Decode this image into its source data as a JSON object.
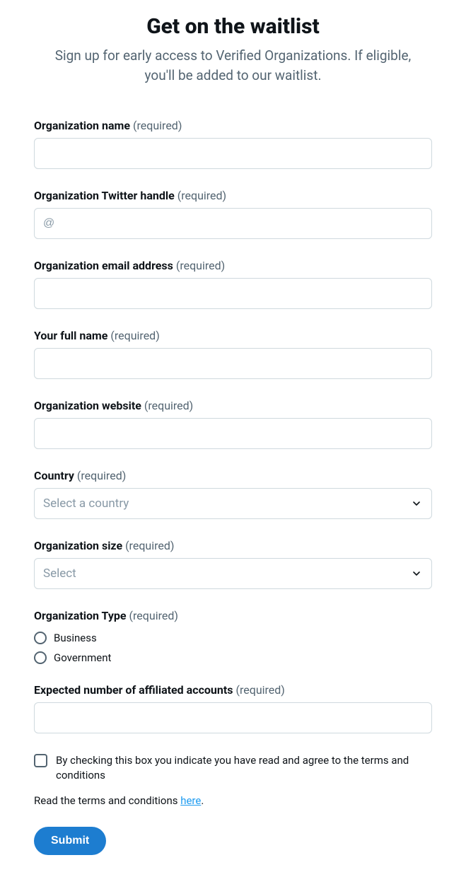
{
  "header": {
    "title": "Get on the waitlist",
    "subtitle": "Sign up for early access to Verified Organizations. If eligible, you'll be added to our waitlist."
  },
  "fields": {
    "org_name": {
      "label": "Organization name",
      "required": "(required)",
      "value": ""
    },
    "twitter_handle": {
      "label": "Organization Twitter handle",
      "required": "(required)",
      "placeholder": "@",
      "value": ""
    },
    "org_email": {
      "label": "Organization email address",
      "required": "(required)",
      "value": ""
    },
    "full_name": {
      "label": "Your full name",
      "required": "(required)",
      "value": ""
    },
    "website": {
      "label": "Organization website",
      "required": "(required)",
      "value": ""
    },
    "country": {
      "label": "Country",
      "required": "(required)",
      "placeholder": "Select a country"
    },
    "org_size": {
      "label": "Organization size",
      "required": "(required)",
      "placeholder": "Select"
    },
    "org_type": {
      "label": "Organization Type",
      "required": "(required)",
      "options": [
        "Business",
        "Government"
      ]
    },
    "affiliated": {
      "label": "Expected number of affiliated accounts",
      "required": "(required)",
      "value": ""
    }
  },
  "consent": {
    "checkbox_text": "By checking this box you indicate you have read and agree to the terms and conditions",
    "terms_prefix": "Read the terms and conditions ",
    "terms_link": "here",
    "terms_suffix": "."
  },
  "buttons": {
    "submit": "Submit"
  }
}
